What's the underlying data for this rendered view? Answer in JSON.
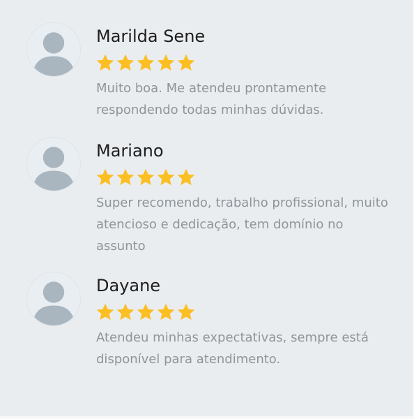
{
  "reviews": [
    {
      "name": "Marilda Sene",
      "rating": 5,
      "comment": "Muito boa. Me atendeu prontamente respondendo todas minhas dúvidas."
    },
    {
      "name": "Mariano",
      "rating": 5,
      "comment": "Super recomendo, trabalho profissional, muito atencioso e dedicação, tem domínio no assunto"
    },
    {
      "name": "Dayane",
      "rating": 5,
      "comment": "Atendeu minhas expectativas, sempre está disponível para atendimento."
    }
  ],
  "icons": {
    "avatar": "default-user-avatar-icon",
    "star": "star-icon"
  },
  "colors": {
    "star": "#fbbf24",
    "background": "#eaedf0",
    "avatar_silhouette": "#a9b6c0",
    "comment_text": "#8e9599"
  }
}
